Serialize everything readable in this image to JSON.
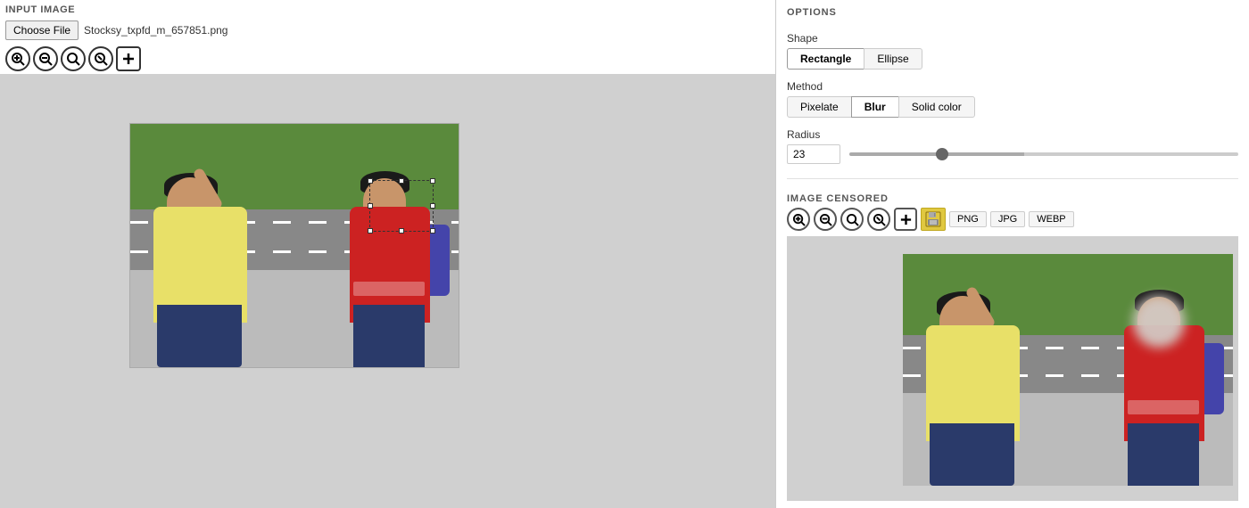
{
  "header": {
    "input_label": "INPUT IMAGE",
    "options_label": "OPTIONS"
  },
  "file": {
    "choose_btn": "Choose File",
    "filename": "Stocksy_txpfd_m_657851.png"
  },
  "zoom_buttons_left": [
    {
      "icon": "🔍",
      "label": "zoom-in-button",
      "symbol": "+"
    },
    {
      "icon": "🔍",
      "label": "zoom-out-button",
      "symbol": "-"
    },
    {
      "icon": "🔍",
      "label": "zoom-fit-button",
      "symbol": "fit"
    },
    {
      "icon": "🔍",
      "label": "zoom-reset-button",
      "symbol": "1:1"
    },
    {
      "icon": "+",
      "label": "add-region-button",
      "symbol": "✛"
    }
  ],
  "options": {
    "shape_label": "Shape",
    "shape_buttons": [
      "Rectangle",
      "Ellipse"
    ],
    "active_shape": "Rectangle",
    "method_label": "Method",
    "method_buttons": [
      "Pixelate",
      "Blur",
      "Solid color"
    ],
    "active_method": "Blur",
    "radius_label": "Radius",
    "radius_value": "23",
    "radius_min": 0,
    "radius_max": 100,
    "radius_percent": 45
  },
  "image_censored": {
    "label": "IMAGE CENSORED",
    "formats": [
      "PNG",
      "JPG",
      "WEBP"
    ]
  },
  "zoom_buttons_right": [
    {
      "label": "zoom-in-btn-r"
    },
    {
      "label": "zoom-out-btn-r"
    },
    {
      "label": "zoom-fit-btn-r"
    },
    {
      "label": "zoom-reset-btn-r"
    },
    {
      "label": "add-btn-r"
    }
  ]
}
